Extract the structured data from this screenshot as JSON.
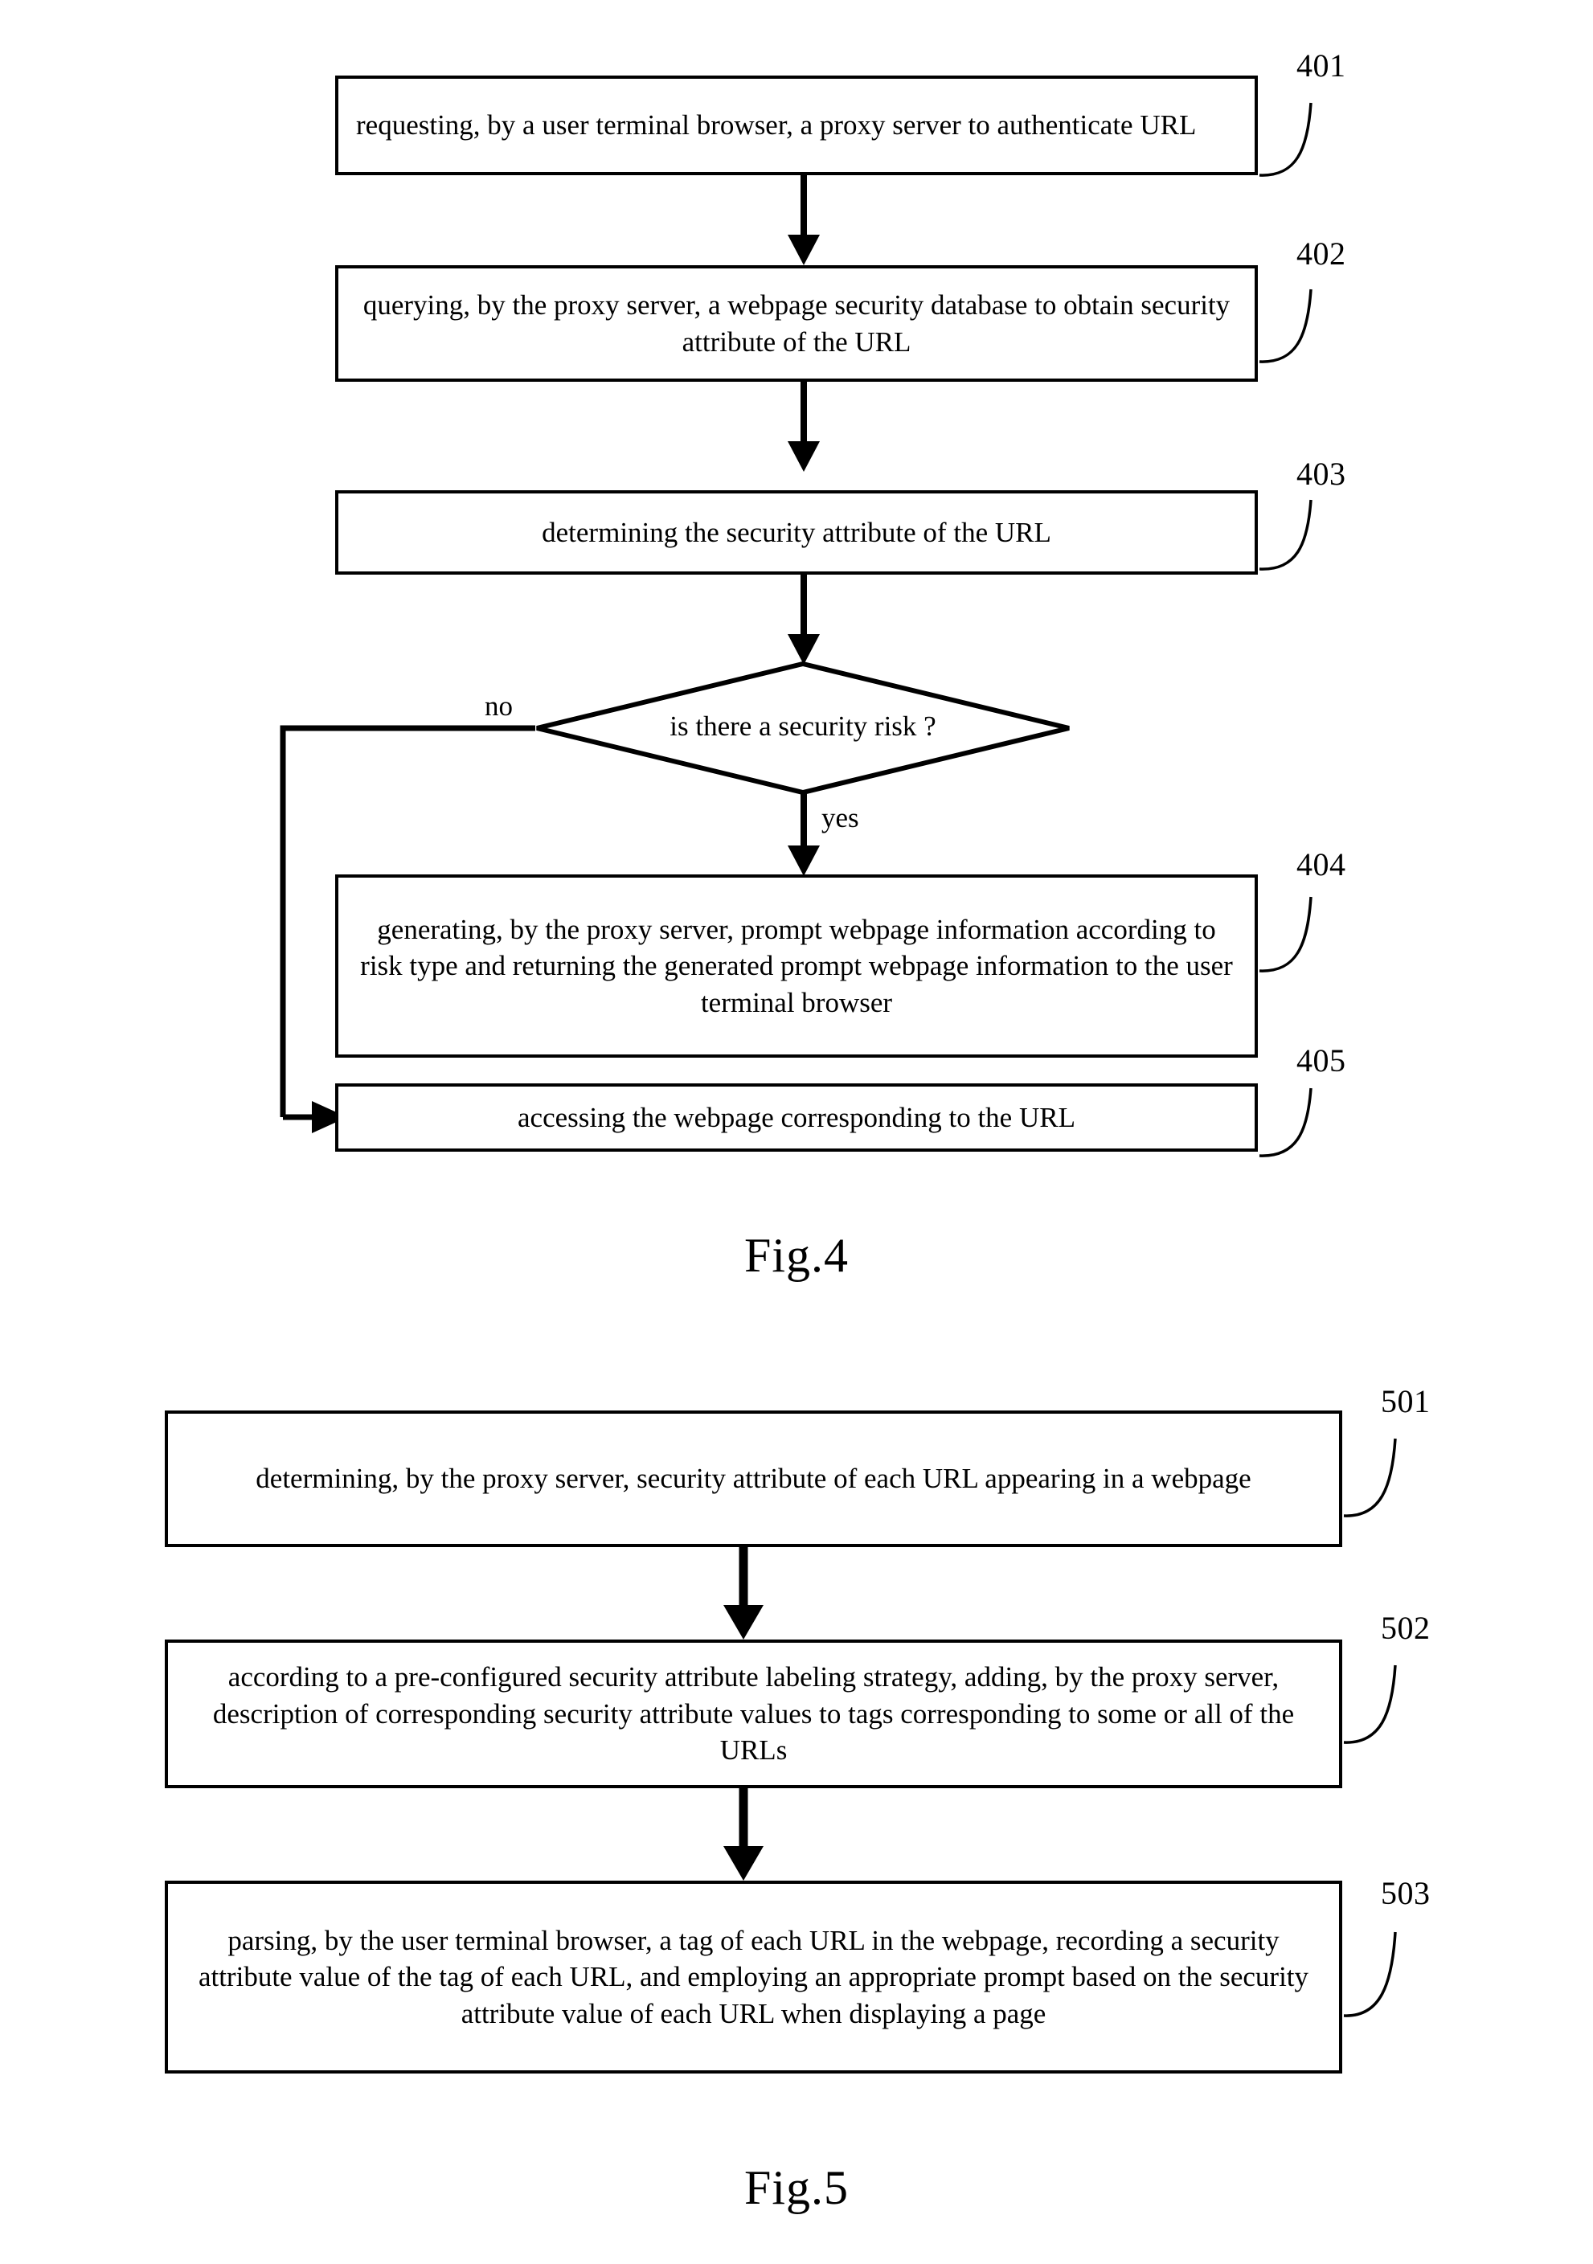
{
  "figures": [
    {
      "id": "fig4",
      "caption": "Fig.4",
      "steps": [
        {
          "ref": "401",
          "text": "requesting, by a user terminal browser, a proxy server to authenticate URL"
        },
        {
          "ref": "402",
          "text": "querying, by the proxy server, a webpage security database to obtain security attribute of the URL"
        },
        {
          "ref": "403",
          "text": "determining the security attribute of the URL"
        },
        {
          "ref": "404",
          "text": "generating, by the proxy server, prompt webpage information according to risk type and returning the generated prompt webpage information to the user terminal browser"
        },
        {
          "ref": "405",
          "text": "accessing the webpage corresponding to the URL"
        }
      ],
      "decision": {
        "text": "is there a security risk ?",
        "no_label": "no",
        "yes_label": "yes"
      }
    },
    {
      "id": "fig5",
      "caption": "Fig.5",
      "steps": [
        {
          "ref": "501",
          "text": "determining, by the proxy server, security attribute of each URL appearing in a webpage"
        },
        {
          "ref": "502",
          "text": "according to a pre-configured security attribute labeling strategy, adding, by the proxy server,  description of corresponding security attribute values to tags corresponding to some or all of the URLs"
        },
        {
          "ref": "503",
          "text": "parsing, by the user terminal browser, a tag of each URL in the webpage, recording a security attribute value of the tag of each URL, and employing an appropriate prompt based on the security attribute value of each URL when displaying a page"
        }
      ]
    }
  ],
  "colors": {
    "stroke": "#000000",
    "background": "#ffffff"
  }
}
